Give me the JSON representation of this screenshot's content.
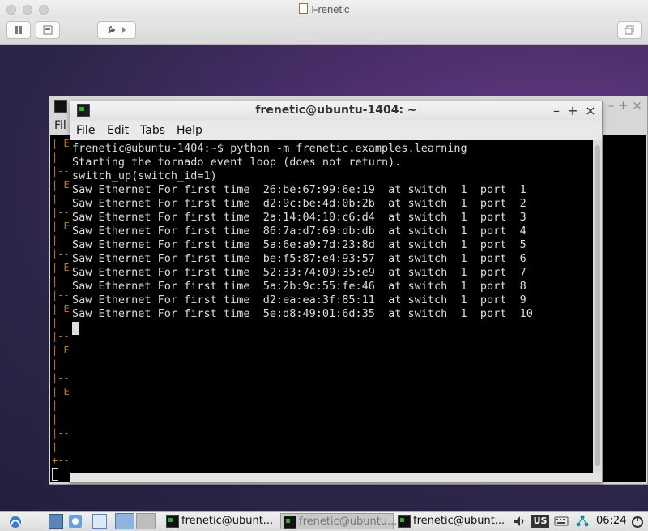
{
  "host": {
    "window_title": "Frenetic"
  },
  "bg_terminal": {
    "menu_partial": "Fil",
    "lines": [
      "| E",
      "|",
      "|--",
      "| E",
      "|",
      "|--",
      "| E",
      "|",
      "|--",
      "| E",
      "|",
      "|--",
      "| E",
      "|",
      "|--",
      "| E",
      "|",
      "|--",
      "| E",
      "|",
      "|",
      "|--",
      "|",
      "+--"
    ],
    "controls": "– + ×"
  },
  "terminal": {
    "title": "frenetic@ubuntu-1404: ~",
    "menu": [
      "File",
      "Edit",
      "Tabs",
      "Help"
    ],
    "controls": {
      "minimize": "–",
      "maximize": "+",
      "close": "×"
    },
    "prompt": "frenetic@ubuntu-1404:~$ python -m frenetic.examples.learning",
    "lines": [
      "Starting the tornado event loop (does not return).",
      "switch_up(switch_id=1)"
    ],
    "ethernet_log": [
      {
        "mac": "26:be:67:99:6e:19",
        "switch": "1",
        "port": "1"
      },
      {
        "mac": "d2:9c:be:4d:0b:2b",
        "switch": "1",
        "port": "2"
      },
      {
        "mac": "2a:14:04:10:c6:d4",
        "switch": "1",
        "port": "3"
      },
      {
        "mac": "86:7a:d7:69:db:db",
        "switch": "1",
        "port": "4"
      },
      {
        "mac": "5a:6e:a9:7d:23:8d",
        "switch": "1",
        "port": "5"
      },
      {
        "mac": "be:f5:87:e4:93:57",
        "switch": "1",
        "port": "6"
      },
      {
        "mac": "52:33:74:09:35:e9",
        "switch": "1",
        "port": "7"
      },
      {
        "mac": "5a:2b:9c:55:fe:46",
        "switch": "1",
        "port": "8"
      },
      {
        "mac": "d2:ea:ea:3f:85:11",
        "switch": "1",
        "port": "9"
      },
      {
        "mac": "5e:d8:49:01:6d:35",
        "switch": "1",
        "port": "10"
      }
    ]
  },
  "taskbar": {
    "tasks": [
      {
        "label": "frenetic@ubunt...",
        "active": false
      },
      {
        "label": "frenetic@ubuntu...",
        "active": true
      },
      {
        "label": "frenetic@ubunt...",
        "active": false
      }
    ],
    "keyboard_layout": "US",
    "clock": "06:24"
  }
}
